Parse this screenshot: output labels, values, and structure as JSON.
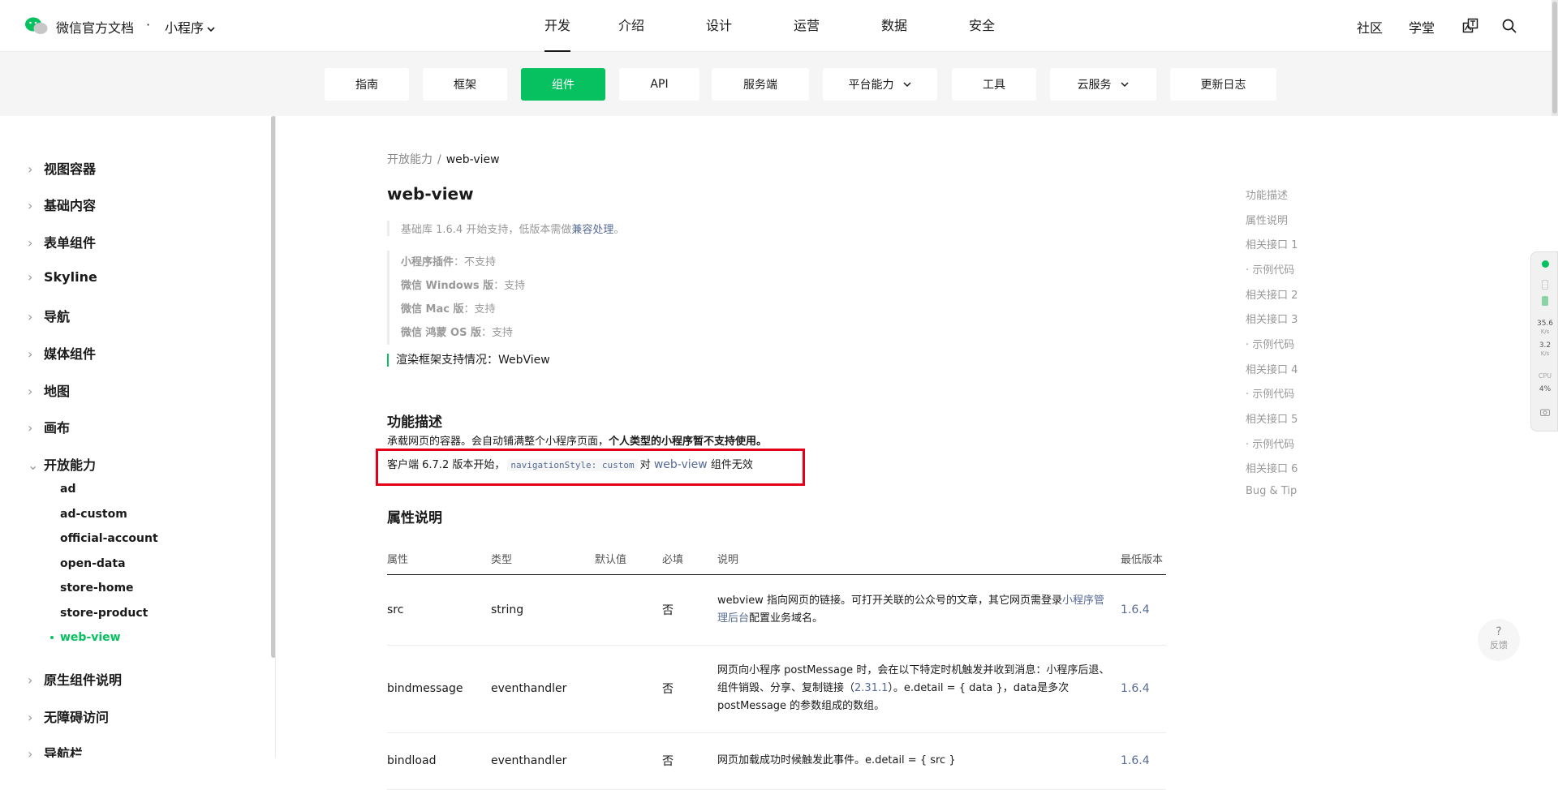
{
  "header": {
    "brand": "微信官方文档",
    "dot": "·",
    "sub_brand": "小程序",
    "nav": [
      "开发",
      "介绍",
      "设计",
      "运营",
      "数据",
      "安全"
    ],
    "community": "社区",
    "academy": "学堂"
  },
  "subnav": {
    "tabs": [
      "指南",
      "框架",
      "组件",
      "API",
      "服务端",
      "平台能力",
      "工具",
      "云服务",
      "更新日志"
    ]
  },
  "sidebar": {
    "groups": [
      "视图容器",
      "基础内容",
      "表单组件",
      "Skyline",
      "导航",
      "媒体组件",
      "地图",
      "画布",
      "开放能力"
    ],
    "children": [
      "ad",
      "ad-custom",
      "official-account",
      "open-data",
      "store-home",
      "store-product",
      "web-view"
    ],
    "groups_after": [
      "原生组件说明",
      "无障碍访问",
      "导航栏"
    ]
  },
  "breadcrumb": {
    "parent": "开放能力",
    "sep": "/",
    "current": "web-view"
  },
  "page": {
    "title": "web-view",
    "notice_prefix": "基础库 1.6.4 开始支持，低版本需做",
    "notice_link": "兼容处理",
    "notice_suffix": "。",
    "support": [
      {
        "label": "小程序插件",
        "value": "：不支持"
      },
      {
        "label": "微信 Windows 版",
        "value": "：支持"
      },
      {
        "label": "微信 Mac 版",
        "value": "：支持"
      },
      {
        "label": "微信 鸿蒙 OS 版",
        "value": "：支持"
      }
    ],
    "render": "渲染框架支持情况：WebView",
    "section1": "功能描述",
    "desc_normal": "承载网页的容器。会自动铺满整个小程序页面，",
    "desc_bold": "个人类型的小程序暂不支持使用。",
    "note_prefix": "客户端 6.7.2 版本开始，",
    "note_code": "navigationStyle: custom",
    "note_mid": "对 ",
    "note_link": "web-view",
    "note_suffix": " 组件无效",
    "section2": "属性说明"
  },
  "table": {
    "headers": [
      "属性",
      "类型",
      "默认值",
      "必填",
      "说明",
      "最低版本"
    ],
    "rows": [
      {
        "name": "src",
        "type": "string",
        "default": "",
        "required": "否",
        "desc1": "webview 指向网页的链接。可打开关联的公众号的文章，其它网页需登录",
        "desc_link": "小程序管理后台",
        "desc2": "配置业务域名。",
        "version": "1.6.4"
      },
      {
        "name": "bindmessage",
        "type": "eventhandler",
        "default": "",
        "required": "否",
        "desc1": "网页向小程序 postMessage 时，会在以下特定时机触发并收到消息：小程序后退、组件销毁、分享、复制链接（",
        "desc_link": "2.31.1",
        "desc2": "）。e.detail = { data }，data是多次 postMessage 的参数组成的数组。",
        "version": "1.6.4"
      },
      {
        "name": "bindload",
        "type": "eventhandler",
        "default": "",
        "required": "否",
        "desc1": "网页加载成功时候触发此事件。e.detail = { src }",
        "desc_link": "",
        "desc2": "",
        "version": "1.6.4"
      }
    ]
  },
  "toc": [
    "功能描述",
    "属性说明",
    "相关接口 1",
    "· 示例代码",
    "相关接口 2",
    "相关接口 3",
    "· 示例代码",
    "相关接口 4",
    "· 示例代码",
    "相关接口 5",
    "· 示例代码",
    "相关接口 6",
    "Bug & Tip"
  ],
  "monitor": {
    "down": "35.6",
    "down_unit": "K/s",
    "up": "3.2",
    "up_unit": "K/s",
    "cpu_label": "CPU",
    "cpu": "4%"
  },
  "feedback": {
    "icon": "?",
    "label": "反馈"
  },
  "colors": {
    "accent": "#07c160",
    "link": "#576b95",
    "highlight": "#e3001b"
  }
}
